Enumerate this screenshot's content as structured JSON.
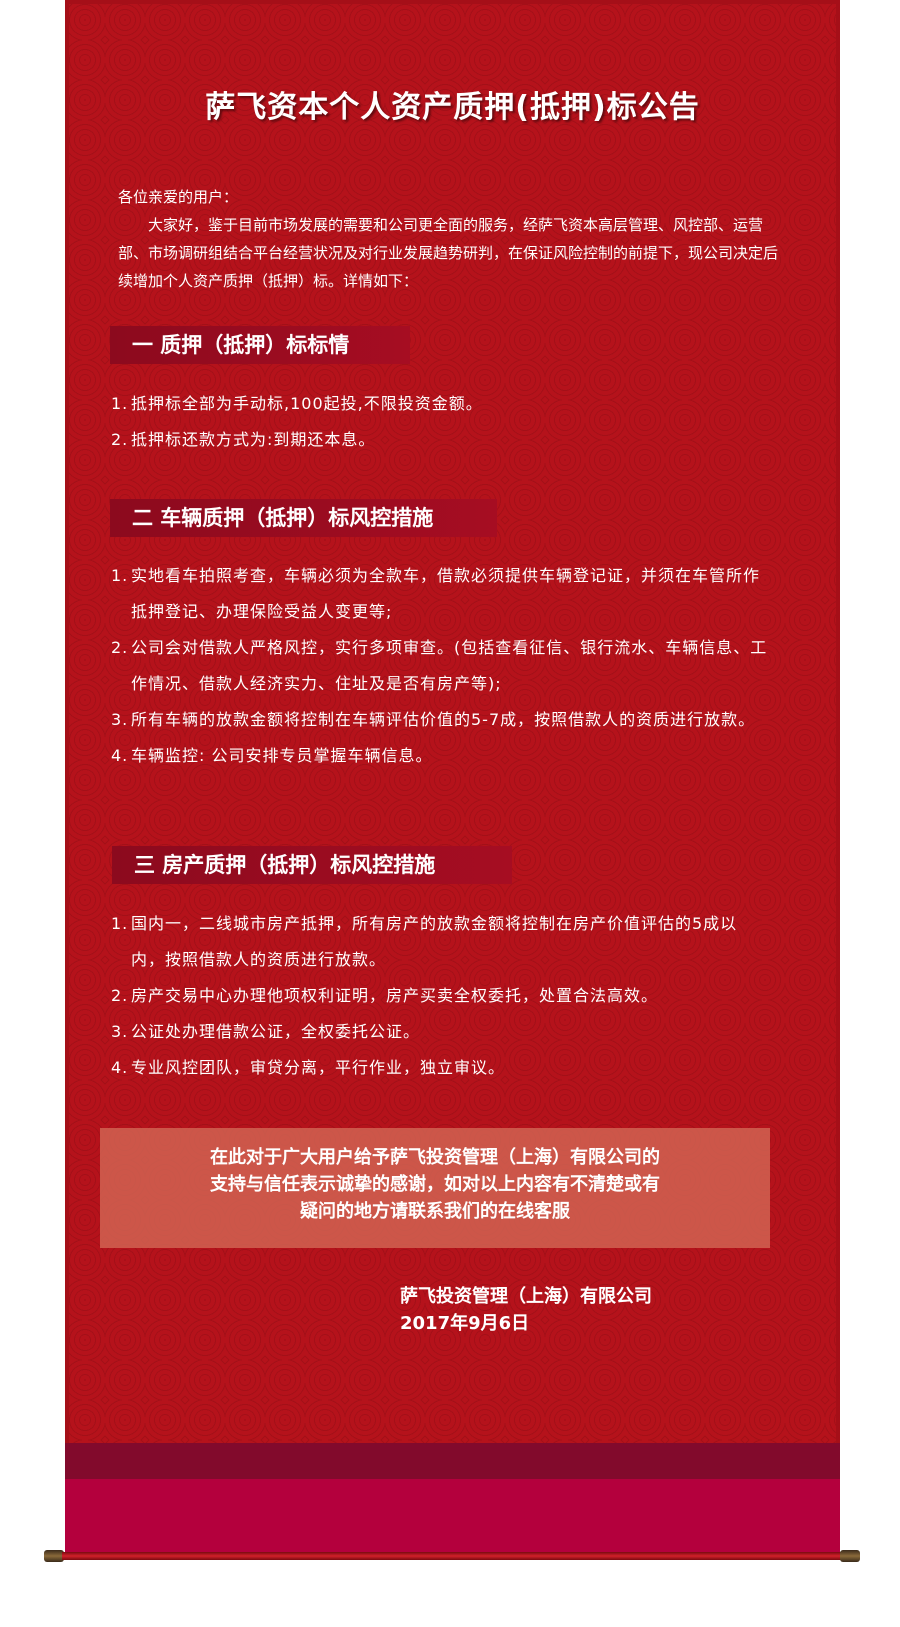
{
  "title": "萨飞资本个人资产质押(抵押)标公告",
  "intro": {
    "greeting": "各位亲爱的用户：",
    "body": "大家好，鉴于目前市场发展的需要和公司更全面的服务，经萨飞资本高层管理、风控部、运营部、市场调研组结合平台经营状况及对行业发展趋势研判，在保证风险控制的前提下，现公司决定后续增加个人资产质押（抵押）标。详情如下："
  },
  "sections": [
    {
      "heading": "一  质押（抵押）标标情",
      "items": [
        {
          "num": "1.",
          "text": "抵押标全部为手动标,100起投,不限投资金额。"
        },
        {
          "num": "2.",
          "text": "抵押标还款方式为:到期还本息。"
        }
      ]
    },
    {
      "heading": "二  车辆质押（抵押）标风控措施",
      "items": [
        {
          "num": "1.",
          "text": "实地看车拍照考查，车辆必须为全款车，借款必须提供车辆登记证，并须在车管所作抵押登记、办理保险受益人变更等;"
        },
        {
          "num": "2.",
          "text": "公司会对借款人严格风控，实行多项审查。(包括查看征信、银行流水、车辆信息、工作情况、借款人经济实力、住址及是否有房产等);"
        },
        {
          "num": "3.",
          "text": "所有车辆的放款金额将控制在车辆评估价值的5-7成，按照借款人的资质进行放款。"
        },
        {
          "num": "4.",
          "text": "车辆监控: 公司安排专员掌握车辆信息。"
        }
      ]
    },
    {
      "heading": "三  房产质押（抵押）标风控措施",
      "items": [
        {
          "num": "1.",
          "text": "国内一，二线城市房产抵押，所有房产的放款金额将控制在房产价值评估的5成以内，按照借款人的资质进行放款。"
        },
        {
          "num": "2.",
          "text": "房产交易中心办理他项权利证明，房产买卖全权委托，处置合法高效。"
        },
        {
          "num": "3.",
          "text": "公证处办理借款公证，全权委托公证。"
        },
        {
          "num": "4.",
          "text": "专业风控团队，审贷分离，平行作业，独立审议。"
        }
      ]
    }
  ],
  "thanks": {
    "line1": "在此对于广大用户给予萨飞投资管理（上海）有限公司的",
    "line2": "支持与信任表示诚挚的感谢，如对以上内容有不清楚或有",
    "line3": "疑问的地方请联系我们的在线客服"
  },
  "signature": {
    "company": "萨飞投资管理（上海）有限公司",
    "date": "2017年9月6日"
  },
  "colors": {
    "background": "#b5121b",
    "section_band": "#8c0a1e",
    "footer_dark": "#820a2c",
    "footer": "#b4003d"
  }
}
